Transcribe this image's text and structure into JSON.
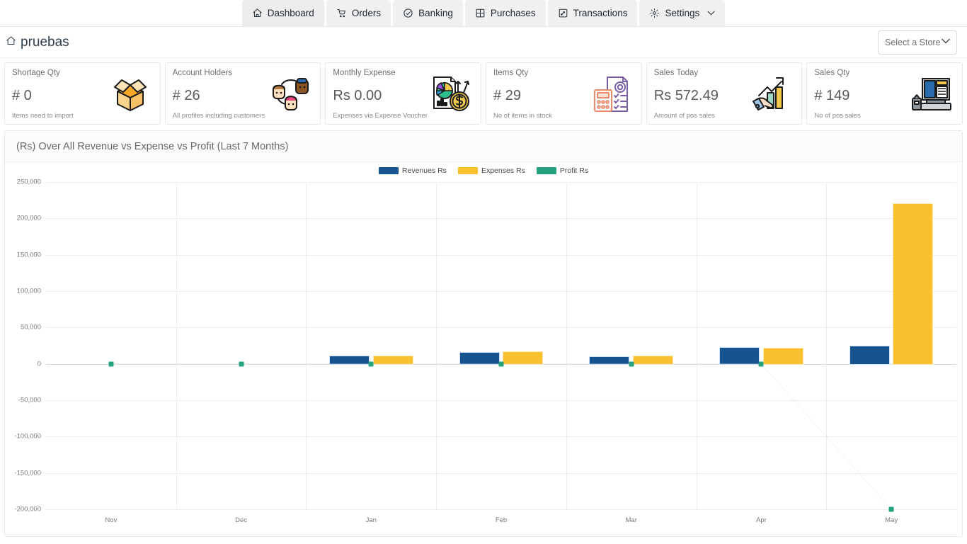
{
  "topnav": {
    "items": [
      {
        "label": "Dashboard",
        "icon": "home-icon",
        "active": true
      },
      {
        "label": "Orders",
        "icon": "cart-icon",
        "active": false
      },
      {
        "label": "Banking",
        "icon": "check-circle-icon",
        "active": false
      },
      {
        "label": "Purchases",
        "icon": "grid-icon",
        "active": false
      },
      {
        "label": "Transactions",
        "icon": "transactions-icon",
        "active": false
      },
      {
        "label": "Settings",
        "icon": "gear-icon",
        "active": false,
        "caret": "⌄"
      }
    ]
  },
  "header": {
    "brand": "pruebas",
    "brand_icon": "home-icon",
    "store_select": {
      "label": "Select a Store",
      "caret": "⌄"
    }
  },
  "kpis": [
    {
      "title": "Shortage Qty",
      "value": "# 0",
      "sub": "Items need to import",
      "icon": "open-box-icon"
    },
    {
      "title": "Account Holders",
      "value": "# 26",
      "sub": "All profiles including customers",
      "icon": "people-group-icon"
    },
    {
      "title": "Monthly Expense",
      "value": "Rs 0.00",
      "sub": "Expenses via Expense Voucher",
      "icon": "pie-chart-dollar-icon"
    },
    {
      "title": "Items Qty",
      "value": "# 29",
      "sub": "No of items in stock",
      "icon": "calculator-checklist-icon"
    },
    {
      "title": "Sales Today",
      "value": "Rs 572.49",
      "sub": "Amount of pos sales",
      "icon": "hand-growth-chart-icon"
    },
    {
      "title": "Sales Qty",
      "value": "# 149",
      "sub": "No of pos sales",
      "icon": "pos-terminal-icon"
    }
  ],
  "chart_panel": {
    "title": "(Rs) Over All Revenue vs Expense vs Profit (Last 7 Months)"
  },
  "chart_data": {
    "type": "bar",
    "title": "(Rs) Over All Revenue vs Expense vs Profit (Last 7 Months)",
    "xlabel": "",
    "ylabel": "",
    "categories": [
      "Nov",
      "Dec",
      "Jan",
      "Feb",
      "Mar",
      "Apr",
      "May"
    ],
    "yticks": [
      250000,
      200000,
      150000,
      100000,
      50000,
      0,
      -50000,
      -100000,
      -150000,
      -200000
    ],
    "ytick_labels": [
      "250,000",
      "200,000",
      "150,000",
      "100,000",
      "50,000",
      "0",
      "-50,000",
      "-100,000",
      "-150,000",
      "-200,000"
    ],
    "ylim": [
      -200000,
      250000
    ],
    "grid": true,
    "legend_position": "top-center",
    "series": [
      {
        "name": "Revenues Rs",
        "type": "bar",
        "color": "#17538f",
        "values": [
          0,
          0,
          10000,
          15000,
          9000,
          22000,
          24000
        ]
      },
      {
        "name": "Expenses Rs",
        "type": "bar",
        "color": "#fbc02d",
        "values": [
          0,
          0,
          10000,
          16000,
          10000,
          21000,
          220000
        ]
      },
      {
        "name": "Profit Rs",
        "type": "line",
        "color": "#26a37e",
        "values": [
          0,
          0,
          0,
          0,
          0,
          0,
          -200000
        ]
      }
    ]
  }
}
